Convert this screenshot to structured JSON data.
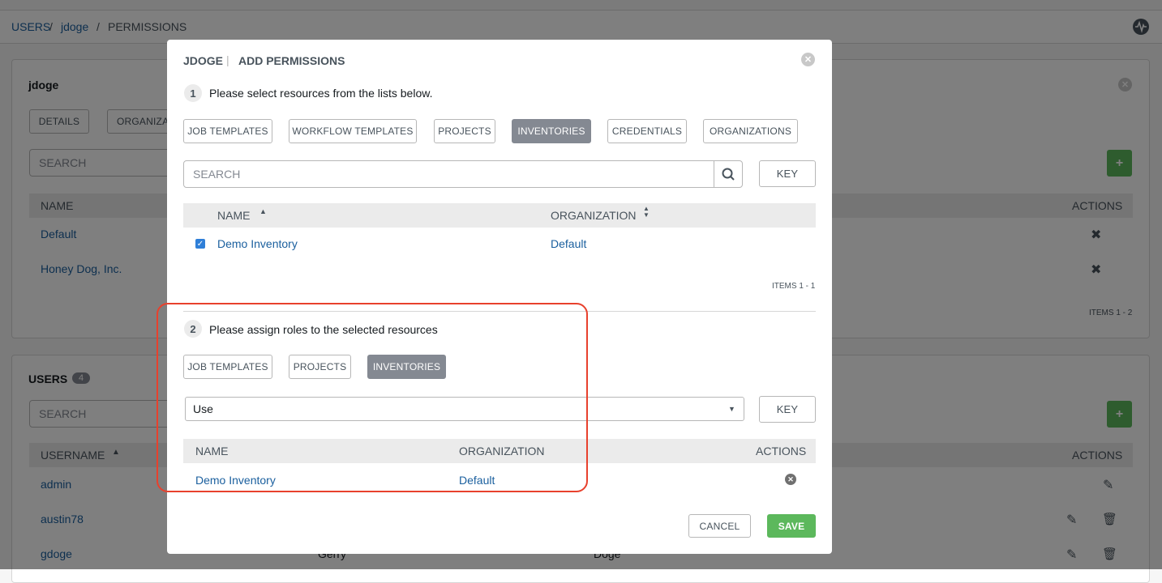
{
  "breadcrumb": {
    "users": "USERS",
    "sep1": "/",
    "user": "jdoge",
    "sep2": "/",
    "current": "PERMISSIONS"
  },
  "user_panel": {
    "title": "jdoge",
    "tabs": [
      "DETAILS",
      "ORGANIZATI"
    ],
    "search_placeholder": "SEARCH",
    "add_label": "+",
    "columns": {
      "name": "NAME",
      "actions": "ACTIONS"
    },
    "rows": [
      {
        "name": "Default"
      },
      {
        "name": "Honey Dog, Inc."
      }
    ],
    "items_label": "ITEMS  1 - 2"
  },
  "users_panel": {
    "title": "USERS",
    "count": "4",
    "search_placeholder": "SEARCH",
    "add_label": "+",
    "columns": {
      "username": "USERNAME",
      "actions": "ACTIONS"
    },
    "rows": [
      {
        "username": "admin",
        "first": "",
        "last": ""
      },
      {
        "username": "austin78",
        "first": "",
        "last": ""
      },
      {
        "username": "gdoge",
        "first": "Gerry",
        "last": "Doge"
      }
    ]
  },
  "modal": {
    "title_user": "JDOGE",
    "title_sep": "|",
    "title_action": "ADD PERMISSIONS",
    "step1": {
      "number": "1",
      "text": "Please select resources from the lists below."
    },
    "resource_tabs": [
      "JOB TEMPLATES",
      "WORKFLOW TEMPLATES",
      "PROJECTS",
      "INVENTORIES",
      "CREDENTIALS",
      "ORGANIZATIONS"
    ],
    "active_resource_tab": "INVENTORIES",
    "search_placeholder": "SEARCH",
    "key_label": "KEY",
    "columns": {
      "name": "NAME",
      "organization": "ORGANIZATION"
    },
    "rows": [
      {
        "name": "Demo Inventory",
        "organization": "Default",
        "checked": true
      }
    ],
    "items_label": "ITEMS  1 - 1",
    "step2": {
      "number": "2",
      "text": "Please assign roles to the selected resources"
    },
    "role_tabs": [
      "JOB TEMPLATES",
      "PROJECTS",
      "INVENTORIES"
    ],
    "active_role_tab": "INVENTORIES",
    "role_select_value": "Use",
    "role_key_label": "KEY",
    "role_columns": {
      "name": "NAME",
      "organization": "ORGANIZATION",
      "actions": "ACTIONS"
    },
    "role_rows": [
      {
        "name": "Demo Inventory",
        "organization": "Default"
      }
    ],
    "cancel_label": "CANCEL",
    "save_label": "SAVE"
  },
  "colors": {
    "link": "#1a5f9e",
    "active_tab": "#848992",
    "save": "#5cb85c",
    "highlight": "#e8412d"
  }
}
